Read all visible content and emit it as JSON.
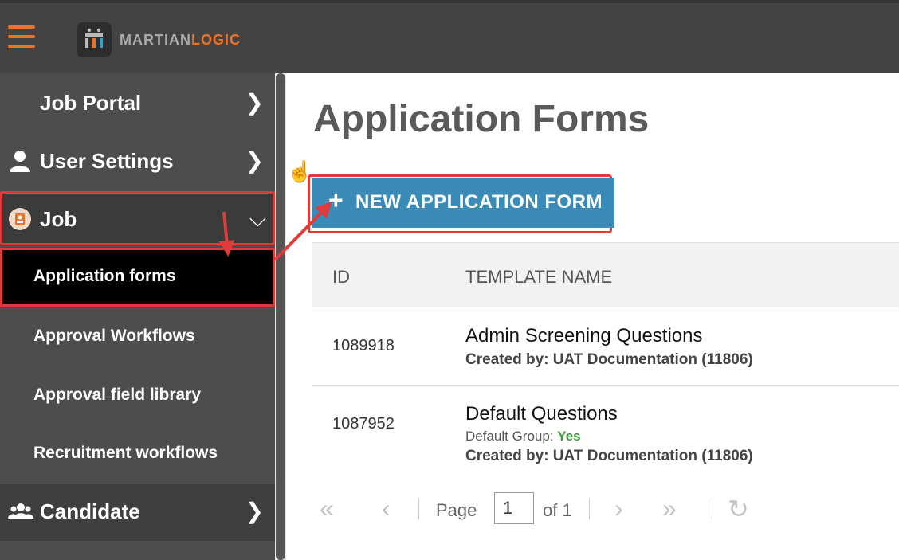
{
  "app": {
    "brand_left": "MARTIAN",
    "brand_right": "LOGIC",
    "accent_color": "#e8742a",
    "highlight_color": "#e03a3a"
  },
  "sidebar": {
    "items": [
      {
        "label": "Job Portal",
        "icon": "none"
      },
      {
        "label": "User Settings",
        "icon": "user-icon"
      },
      {
        "label": "Job",
        "icon": "job-badge-icon"
      },
      {
        "label": "Candidate",
        "icon": "users-icon"
      }
    ],
    "job_submenu": [
      {
        "label": "Application forms",
        "active": true
      },
      {
        "label": "Approval Workflows",
        "active": false
      },
      {
        "label": "Approval field library",
        "active": false
      },
      {
        "label": "Recruitment workflows",
        "active": false
      }
    ]
  },
  "main": {
    "title": "Application Forms",
    "new_button": {
      "plus": "+",
      "label": "NEW APPLICATION FORM"
    },
    "table": {
      "headers": [
        "ID",
        "TEMPLATE NAME"
      ],
      "rows": [
        {
          "id": "1089918",
          "name": "Admin Screening Questions",
          "created_by": "Created by: UAT Documentation (11806)"
        },
        {
          "id": "1087952",
          "name": "Default Questions",
          "group_label": "Default Group:",
          "group_value": "Yes",
          "created_by": "Created by: UAT Documentation (11806)"
        }
      ]
    },
    "pager": {
      "first": "«",
      "prev": "‹",
      "page_label": "Page",
      "page_value": "1",
      "of_label": "of 1",
      "next": "›",
      "last": "»",
      "refresh": "↻"
    }
  }
}
